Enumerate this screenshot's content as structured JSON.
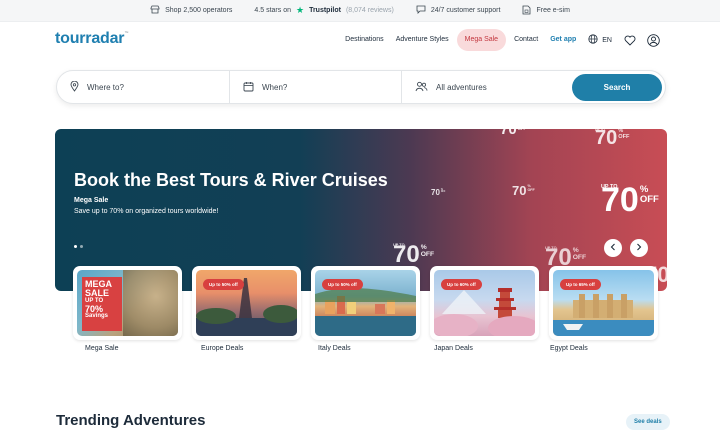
{
  "topbar": {
    "operators": "Shop 2,500 operators",
    "rating_prefix": "4.5 stars on",
    "trustpilot": "Trustpilot",
    "reviews": "(8,074 reviews)",
    "support": "24/7 customer support",
    "esim": "Free e-sim"
  },
  "header": {
    "logo": "tourradar",
    "nav": [
      "Destinations",
      "Adventure Styles",
      "Mega Sale",
      "Contact",
      "Get app"
    ],
    "language": "EN"
  },
  "search": {
    "where_placeholder": "Where to?",
    "when_placeholder": "When?",
    "adventures_value": "All adventures",
    "button": "Search"
  },
  "hero": {
    "title": "Book the Best Tours & River Cruises",
    "subtitle": "Mega Sale",
    "description": "Save up to 70% on organized tours worldwide!",
    "promo": {
      "upto": "UP TO",
      "value": "70",
      "pct": "%",
      "off": "OFF"
    },
    "slide_count": 2,
    "active_slide": 1
  },
  "deals": [
    {
      "label": "Mega Sale",
      "badge": "",
      "sign_top": "MEGA SALE",
      "sign_pct": "70%",
      "sign_bottom": "Savings",
      "sign_upto": "UP TO"
    },
    {
      "label": "Europe Deals",
      "badge": "Up to 50% off"
    },
    {
      "label": "Italy Deals",
      "badge": "Up to 50% off"
    },
    {
      "label": "Japan Deals",
      "badge": "Up to 60% off"
    },
    {
      "label": "Egypt Deals",
      "badge": "Up to 65% off"
    }
  ],
  "trending": {
    "title": "Trending Adventures",
    "see_deals": "See deals"
  },
  "colors": {
    "brand": "#1f7fb0",
    "search_button": "#1f7fa8",
    "mega_pill_bg": "#f9dadb",
    "badge": "#d8403f",
    "hero_left": "#0d4055",
    "hero_right": "#c84d55"
  }
}
